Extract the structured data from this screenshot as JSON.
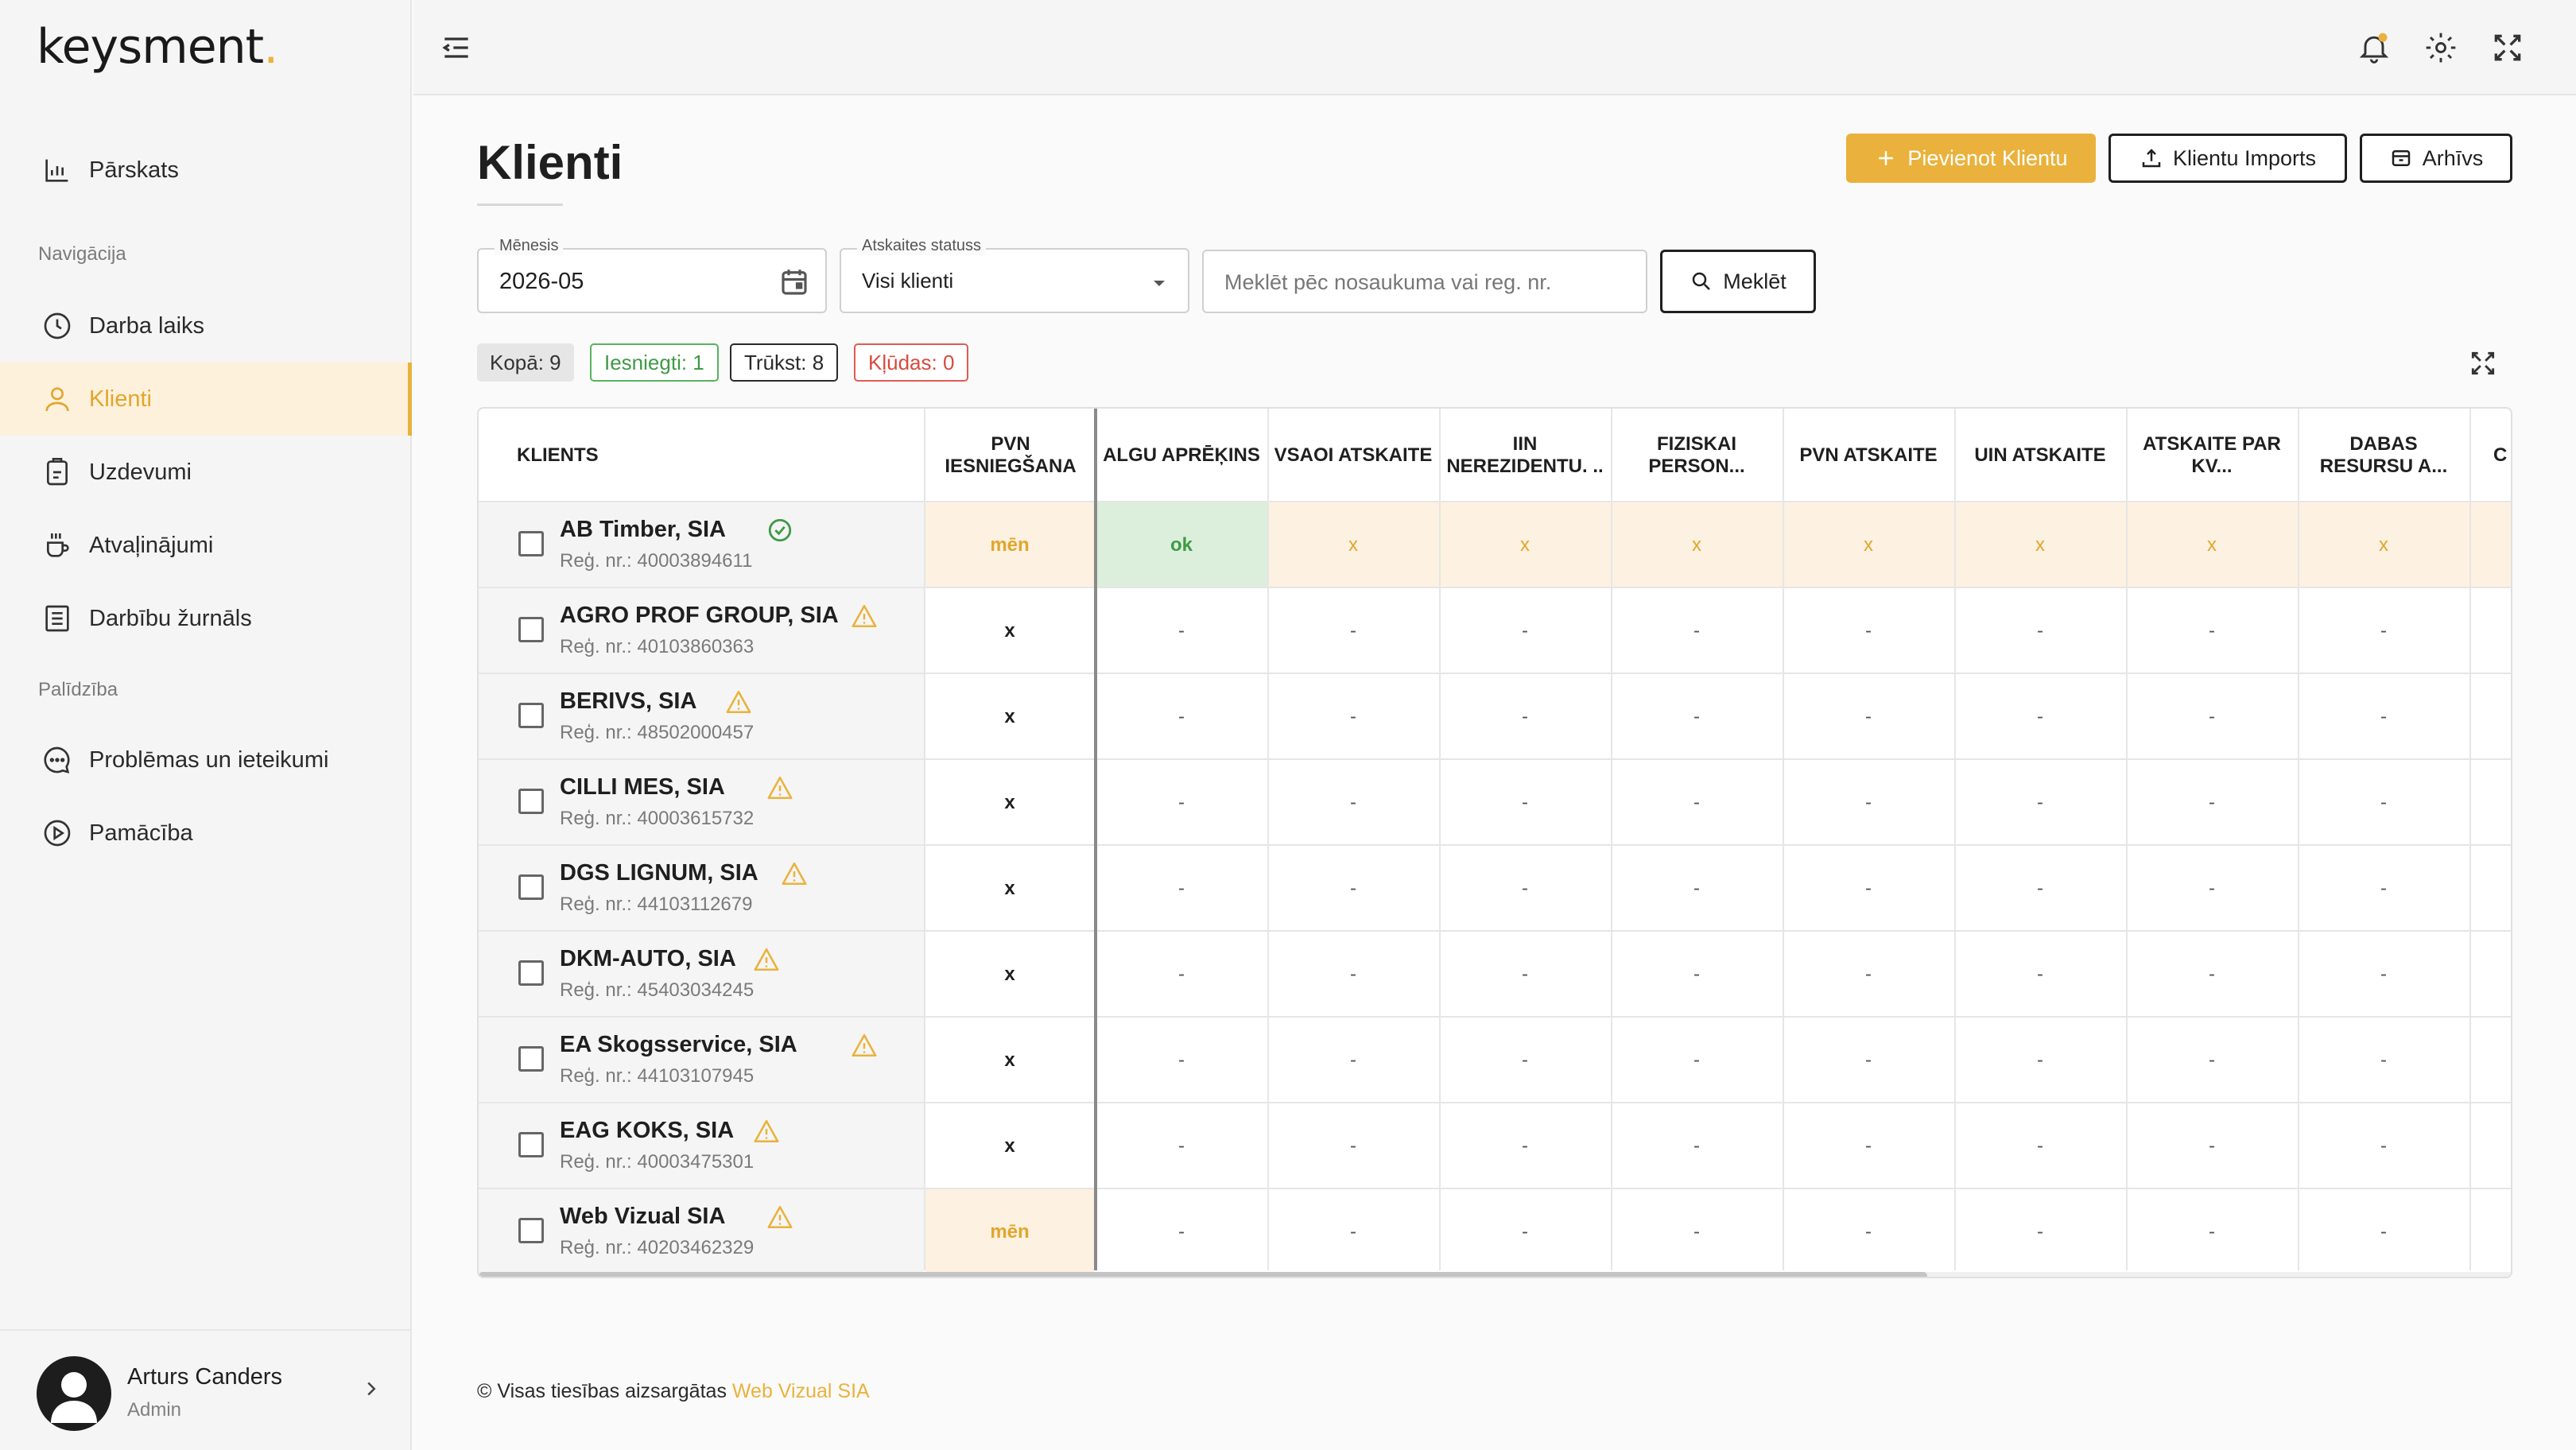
{
  "brand": {
    "logo": "keysment",
    "accent": "#eab23c"
  },
  "sidebar": {
    "overview": "Pārskats",
    "nav_section": "Navigācija",
    "items": [
      {
        "label": "Darba laiks",
        "icon": "clock-icon"
      },
      {
        "label": "Klienti",
        "icon": "user-icon",
        "active": true
      },
      {
        "label": "Uzdevumi",
        "icon": "clipboard-icon"
      },
      {
        "label": "Atvaļinājumi",
        "icon": "coffee-icon"
      },
      {
        "label": "Darbību žurnāls",
        "icon": "log-icon"
      }
    ],
    "help_section": "Palīdzība",
    "help_items": [
      {
        "label": "Problēmas un ieteikumi",
        "icon": "chat-icon"
      },
      {
        "label": "Pamācība",
        "icon": "play-icon"
      }
    ],
    "user": {
      "name": "Arturs Canders",
      "role": "Admin"
    }
  },
  "page": {
    "title": "Klienti",
    "buttons": {
      "add": "Pievienot Klientu",
      "import": "Klientu Imports",
      "archive": "Arhīvs"
    }
  },
  "filters": {
    "month_label": "Mēnesis",
    "month_value": "2026-05",
    "status_label": "Atskaites statuss",
    "status_value": "Visi klienti",
    "search_placeholder": "Meklēt pēc nosaukuma vai reg. nr.",
    "search_button": "Meklēt"
  },
  "summary": {
    "total": "Kopā: 9",
    "submitted": "Iesniegti: 1",
    "missing": "Trūkst: 8",
    "errors": "Kļūdas: 0"
  },
  "table": {
    "headers": [
      "KLIENTS",
      "PVN IESNIEGŠANA",
      "ALGU APRĒĶINS",
      "VSAOI ATSKAITE",
      "IIN NEREZIDENTU. ..",
      "FIZISKAI PERSON...",
      "PVN ATSKAITE",
      "UIN ATSKAITE",
      "ATSKAITE PAR KV...",
      "DABAS RESURSU A...",
      "C"
    ],
    "rows": [
      {
        "name": "AB Timber, SIA",
        "reg": "Reģ. nr.: 40003894611",
        "status": "ok",
        "cells": [
          "mēn",
          "ok",
          "x",
          "x",
          "x",
          "x",
          "x",
          "x",
          "x"
        ]
      },
      {
        "name": "AGRO PROF GROUP, SIA",
        "reg": "Reģ. nr.: 40103860363",
        "status": "warn",
        "cells": [
          "x",
          "-",
          "-",
          "-",
          "-",
          "-",
          "-",
          "-",
          "-"
        ]
      },
      {
        "name": "BERIVS, SIA",
        "reg": "Reģ. nr.: 48502000457",
        "status": "warn",
        "cells": [
          "x",
          "-",
          "-",
          "-",
          "-",
          "-",
          "-",
          "-",
          "-"
        ]
      },
      {
        "name": "CILLI MES, SIA",
        "reg": "Reģ. nr.: 40003615732",
        "status": "warn",
        "cells": [
          "x",
          "-",
          "-",
          "-",
          "-",
          "-",
          "-",
          "-",
          "-"
        ]
      },
      {
        "name": "DGS LIGNUM, SIA",
        "reg": "Reģ. nr.: 44103112679",
        "status": "warn",
        "cells": [
          "x",
          "-",
          "-",
          "-",
          "-",
          "-",
          "-",
          "-",
          "-"
        ]
      },
      {
        "name": "DKM-AUTO, SIA",
        "reg": "Reģ. nr.: 45403034245",
        "status": "warn",
        "cells": [
          "x",
          "-",
          "-",
          "-",
          "-",
          "-",
          "-",
          "-",
          "-"
        ]
      },
      {
        "name": "EA Skogsservice, SIA",
        "reg": "Reģ. nr.: 44103107945",
        "status": "warn",
        "cells": [
          "x",
          "-",
          "-",
          "-",
          "-",
          "-",
          "-",
          "-",
          "-"
        ]
      },
      {
        "name": "EAG KOKS, SIA",
        "reg": "Reģ. nr.: 40003475301",
        "status": "warn",
        "cells": [
          "x",
          "-",
          "-",
          "-",
          "-",
          "-",
          "-",
          "-",
          "-"
        ]
      },
      {
        "name": "Web Vizual SIA",
        "reg": "Reģ. nr.: 40203462329",
        "status": "warn",
        "cells": [
          "mēn",
          "-",
          "-",
          "-",
          "-",
          "-",
          "-",
          "-",
          "-"
        ]
      }
    ]
  },
  "footer": {
    "text": "© Visas tiesības aizsargātas",
    "link": "Web Vizual SIA"
  }
}
